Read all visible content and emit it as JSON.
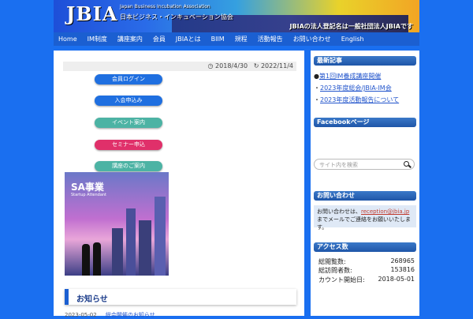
{
  "header": {
    "logo": "JBIA",
    "logo_en": "Japan Business Incubation Association",
    "logo_jp": "日本ビジネス・インキュベーション協会",
    "tagline": "JBIAの法人登記名は一般社団法人JBIAです"
  },
  "nav": {
    "items": [
      "Home",
      "IM制度",
      "講座案内",
      "会員",
      "JBIAとは",
      "BIIM",
      "規程",
      "活動報告",
      "お問い合わせ",
      "English"
    ]
  },
  "post": {
    "date_published": "2018/4/30",
    "date_updated": "2022/11/4"
  },
  "buttons": [
    {
      "label": "会員ログイン",
      "color": "#1f6fe0"
    },
    {
      "label": "入会申込み",
      "color": "#1f6fe0"
    },
    {
      "label": "イベント案内",
      "color": "#4cb3a4"
    },
    {
      "label": "セミナー申込",
      "color": "#e0306a"
    },
    {
      "label": "講座のご案内",
      "color": "#4cb3a4"
    }
  ],
  "promo": {
    "title": "SA事業",
    "subtitle": "Startup Attendant"
  },
  "news": {
    "heading": "お知らせ",
    "first_date": "2023-05-02",
    "first_title": "総会開催のお知らせ"
  },
  "sidebar": {
    "recent_title": "最新記事",
    "recent": [
      {
        "prefix": "●",
        "text": "第1回IM養成講座開催"
      },
      {
        "prefix": "・",
        "text": "2023年度総会/JBIA-IM会"
      },
      {
        "prefix": "・",
        "text": "2023年度活動報告について"
      }
    ],
    "facebook_title": "Facebookページ",
    "search_placeholder": "サイト内を検索",
    "contact_title": "お問い合わせ",
    "contact_lead": "お問い合わせは、",
    "contact_email": "reception@jbia.jp",
    "contact_rest": "までメールでご連絡をお願いいたします。",
    "stats_title": "アクセス数",
    "stats": [
      {
        "label": "総閲覧数:",
        "value": "268965"
      },
      {
        "label": "総訪問者数:",
        "value": "153816"
      },
      {
        "label": "カウント開始日:",
        "value": "2018-05-01"
      }
    ]
  }
}
